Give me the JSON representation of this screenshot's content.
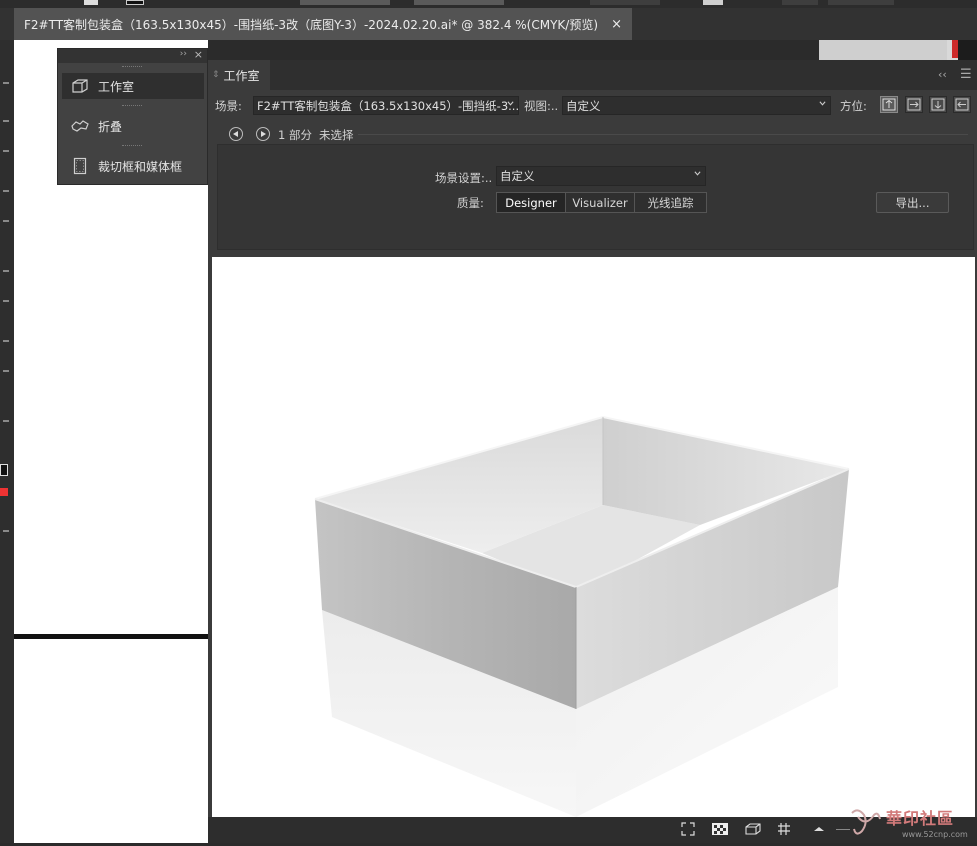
{
  "document": {
    "tab_title": "F2#TT客制包装盒（163.5x130x45）-围挡纸-3改（底图Y-3）-2024.02.20.ai* @ 382.4 %(CMYK/预览)",
    "tab_close": "×"
  },
  "panel_3d": {
    "collapse": "››",
    "close": "×",
    "items": [
      {
        "label": "工作室",
        "icon": "cube-icon"
      },
      {
        "label": "折叠",
        "icon": "fold-icon"
      },
      {
        "label": "裁切框和媒体框",
        "icon": "crop-frame-icon"
      }
    ]
  },
  "workroom": {
    "title": "工作室",
    "collapse": "‹‹",
    "menu": "☰",
    "scene_label": "场景:",
    "scene_value": "F2#TT客制包装盒（163.5x130x45）-围挡纸-3...",
    "view_label": "视图:..",
    "view_value": "自定义",
    "orientation_label": "方位:",
    "part_count": "1 部分",
    "selection": "未选择",
    "scene_settings_label": "场景设置:..",
    "scene_settings_value": "自定义",
    "quality_label": "质量:",
    "quality_options": [
      "Designer",
      "Visualizer",
      "光线追踪"
    ],
    "quality_selected": "Designer",
    "export_label": "导出..."
  },
  "bottom_bar": {
    "icons": [
      "fit-view-icon",
      "checker-toggle-icon",
      "box-view-icon",
      "grid-icon",
      "light-icon"
    ]
  },
  "watermark": {
    "text": "華印社區",
    "url": "www.52cnp.com"
  },
  "colors": {
    "accent_red": "#cc2a2a",
    "panel_bg": "#3b3b3b",
    "dark_bg": "#2b2b2b"
  }
}
